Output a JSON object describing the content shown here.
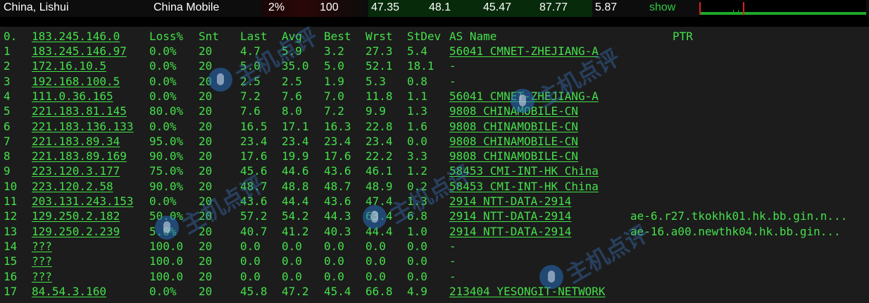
{
  "summary": {
    "location": "China, Lishui",
    "isp": "China Mobile",
    "loss": "2%",
    "snt": "100",
    "last": "47.35",
    "avg": "48.1",
    "best": "45.47",
    "wrst": "87.77",
    "stdev": "5.87",
    "show_label": "show",
    "graph_icon": "latency-graph-icon"
  },
  "table": {
    "headers": {
      "idx": "0.",
      "host": "183.245.146.0",
      "loss": "Loss%",
      "snt": "Snt",
      "last": "Last",
      "avg": "Avg",
      "best": "Best",
      "wrst": "Wrst",
      "stdev": "StDev",
      "as": "AS Name",
      "ptr": "PTR"
    },
    "rows": [
      {
        "idx": "1",
        "host": "183.245.146.97",
        "loss": "0.0%",
        "snt": "20",
        "last": "4.7",
        "avg": "5.9",
        "best": "3.2",
        "wrst": "27.3",
        "stdev": "5.4",
        "as": "56041 CMNET-ZHEJIANG-A",
        "ptr": ""
      },
      {
        "idx": "2",
        "host": "172.16.10.5",
        "loss": "0.0%",
        "snt": "20",
        "last": "5.0",
        "avg": "35.0",
        "best": "5.0",
        "wrst": "52.1",
        "stdev": "18.1",
        "as": "-",
        "ptr": ""
      },
      {
        "idx": "3",
        "host": "192.168.100.5",
        "loss": "0.0%",
        "snt": "20",
        "last": "2.5",
        "avg": "2.5",
        "best": "1.9",
        "wrst": "5.3",
        "stdev": "0.8",
        "as": "-",
        "ptr": ""
      },
      {
        "idx": "4",
        "host": "111.0.36.165",
        "loss": "0.0%",
        "snt": "20",
        "last": "7.2",
        "avg": "7.6",
        "best": "7.0",
        "wrst": "11.8",
        "stdev": "1.1",
        "as": "56041 CMNET-ZHEJIANG-A",
        "ptr": ""
      },
      {
        "idx": "5",
        "host": "221.183.81.145",
        "loss": "80.0%",
        "snt": "20",
        "last": "7.6",
        "avg": "8.0",
        "best": "7.2",
        "wrst": "9.9",
        "stdev": "1.3",
        "as": "9808  CHINAMOBILE-CN",
        "ptr": ""
      },
      {
        "idx": "6",
        "host": "221.183.136.133",
        "loss": "0.0%",
        "snt": "20",
        "last": "16.5",
        "avg": "17.1",
        "best": "16.3",
        "wrst": "22.8",
        "stdev": "1.6",
        "as": "9808  CHINAMOBILE-CN",
        "ptr": ""
      },
      {
        "idx": "7",
        "host": "221.183.89.34",
        "loss": "95.0%",
        "snt": "20",
        "last": "23.4",
        "avg": "23.4",
        "best": "23.4",
        "wrst": "23.4",
        "stdev": "0.0",
        "as": "9808  CHINAMOBILE-CN",
        "ptr": ""
      },
      {
        "idx": "8",
        "host": "221.183.89.169",
        "loss": "90.0%",
        "snt": "20",
        "last": "17.6",
        "avg": "19.9",
        "best": "17.6",
        "wrst": "22.2",
        "stdev": "3.3",
        "as": "9808  CHINAMOBILE-CN",
        "ptr": ""
      },
      {
        "idx": "9",
        "host": "223.120.3.177",
        "loss": "75.0%",
        "snt": "20",
        "last": "45.6",
        "avg": "44.6",
        "best": "43.6",
        "wrst": "46.1",
        "stdev": "1.2",
        "as": "58453 CMI-INT-HK China",
        "ptr": ""
      },
      {
        "idx": "10",
        "host": "223.120.2.58",
        "loss": "90.0%",
        "snt": "20",
        "last": "48.7",
        "avg": "48.8",
        "best": "48.7",
        "wrst": "48.9",
        "stdev": "0.2",
        "as": "58453 CMI-INT-HK China",
        "ptr": ""
      },
      {
        "idx": "11",
        "host": "203.131.243.153",
        "loss": "0.0%",
        "snt": "20",
        "last": "43.6",
        "avg": "44.4",
        "best": "43.6",
        "wrst": "47.4",
        "stdev": "1.3",
        "as": "2914  NTT-DATA-2914",
        "ptr": ""
      },
      {
        "idx": "12",
        "host": "129.250.2.182",
        "loss": "50.0%",
        "snt": "20",
        "last": "57.2",
        "avg": "54.2",
        "best": "44.3",
        "wrst": "63.4",
        "stdev": "6.8",
        "as": "2914  NTT-DATA-2914",
        "ptr": "ae-6.r27.tkokhk01.hk.bb.gin.n..."
      },
      {
        "idx": "13",
        "host": "129.250.2.239",
        "loss": "5.0%",
        "snt": "20",
        "last": "40.7",
        "avg": "41.2",
        "best": "40.3",
        "wrst": "44.4",
        "stdev": "1.0",
        "as": "2914  NTT-DATA-2914",
        "ptr": "ae-16.a00.newthk04.hk.bb.gin..."
      },
      {
        "idx": "14",
        "host": "???",
        "loss": "100.0",
        "snt": "20",
        "last": "0.0",
        "avg": "0.0",
        "best": "0.0",
        "wrst": "0.0",
        "stdev": "0.0",
        "as": "-",
        "ptr": ""
      },
      {
        "idx": "15",
        "host": "???",
        "loss": "100.0",
        "snt": "20",
        "last": "0.0",
        "avg": "0.0",
        "best": "0.0",
        "wrst": "0.0",
        "stdev": "0.0",
        "as": "-",
        "ptr": ""
      },
      {
        "idx": "16",
        "host": "???",
        "loss": "100.0",
        "snt": "20",
        "last": "0.0",
        "avg": "0.0",
        "best": "0.0",
        "wrst": "0.0",
        "stdev": "0.0",
        "as": "-",
        "ptr": ""
      },
      {
        "idx": "17",
        "host": "84.54.3.160",
        "loss": "0.0%",
        "snt": "20",
        "last": "45.8",
        "avg": "47.2",
        "best": "45.4",
        "wrst": "66.8",
        "stdev": "4.9",
        "as": "213404 YESONGIT-NETWORK",
        "ptr": ""
      }
    ]
  },
  "watermark": {
    "text": "主机点评",
    "icon": "watermark-logo-icon"
  },
  "colors": {
    "terminal_text": "#45e04a",
    "terminal_bg": "#1c1c1c",
    "graph_line": "#1ea82a",
    "graph_spike": "#e02020"
  }
}
